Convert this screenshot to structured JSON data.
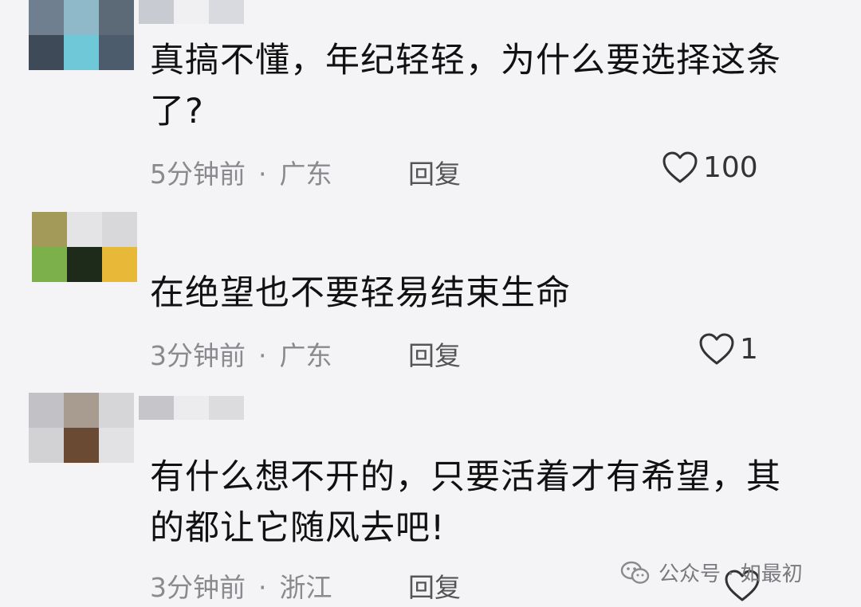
{
  "comments": [
    {
      "text_lines": [
        "真搞不懂，年纪轻轻，为什么要选择这条",
        "了?"
      ],
      "time": "5分钟前",
      "location": "广东",
      "reply_label": "回复",
      "likes": "100",
      "avatar_colors": [
        "#6f7f8f",
        "#8fb8c8",
        "#5c6a78",
        "#3e4a58",
        "#6fc8d8",
        "#4c5c6c"
      ],
      "name_colors": [
        "#c8ccd2",
        "#f0f0f2",
        "#d8dadf"
      ]
    },
    {
      "text_lines": [
        "在绝望也不要轻易结束生命"
      ],
      "time": "3分钟前",
      "location": "广东",
      "reply_label": "回复",
      "likes": "1",
      "avatar_colors": [
        "#a39a5a",
        "#e4e4e6",
        "#d8d8da",
        "#7cb04a",
        "#1e2a1a",
        "#e8b838"
      ]
    },
    {
      "text_lines": [
        "有什么想不开的，只要活着才有希望，其",
        "的都让它随风去吧!"
      ],
      "time": "3分钟前",
      "location": "浙江",
      "reply_label": "回复",
      "likes": "",
      "avatar_colors": [
        "#c2c2c6",
        "#a89c90",
        "#d6d6d8",
        "#d2d2d4",
        "#6a4a32",
        "#e2e2e4"
      ],
      "name_colors": [
        "#c6c6ca",
        "#ececee",
        "#dcdcde"
      ]
    }
  ],
  "watermark": {
    "text": "公众号 · 如最初",
    "icon": "wechat-icon"
  },
  "colors": {
    "background": "#f4f4f6",
    "text": "#111111",
    "meta": "#8a8a8e"
  },
  "icons": {
    "like": "heart-outline-icon"
  }
}
